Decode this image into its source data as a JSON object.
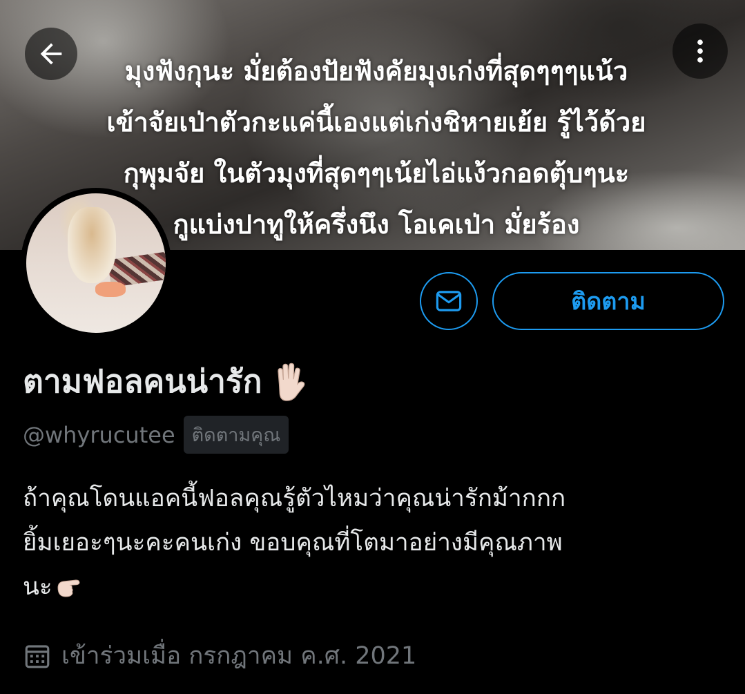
{
  "banner": {
    "caption_lines": [
      "มุงฟังกุนะ มั่ยต้องปัยฟังคัยมุงเก่งที่สุดๆๆๆแน้ว",
      "เข้าจัยเป่าตัวกะแค่นี้เองแต่เก่งชิหายเย้ย รู้ไว้ด้วย",
      "กุพุมจัย ในตัวมุงที่สุดๆๆเน้ยไอ่แง้วกอดตุ้บๆนะ",
      "กูแบ่งปาทูให้ครึ่งนึง โอเคเป่า มั่ยร้อง"
    ]
  },
  "nav": {
    "back_icon": "arrow-left-icon",
    "more_icon": "more-vertical-icon"
  },
  "profile": {
    "display_name": "ตามฟอลคนน่ารัก",
    "name_emoji": "raised-hand-emoji",
    "handle": "@whyrucutee",
    "follows_you_label": "ติดตามคุณ",
    "bio_lines": [
      "ถ้าคุณโดนแอคนี้ฟอลคุณรู้ตัวไหมว่าคุณน่ารักม้ากกก",
      "ยิ้มเยอะๆนะคะคนเก่ง ขอบคุณที่โตมาอย่างมีคุณภาพ",
      "นะ"
    ],
    "bio_emoji": "pointing-right-emoji",
    "joined_text": "เข้าร่วมเมื่อ กรกฎาคม ค.ศ. 2021"
  },
  "actions": {
    "message_icon": "mail-icon",
    "follow_label": "ติดตาม"
  },
  "colors": {
    "accent": "#1d9bf0",
    "background": "#000000",
    "text_primary": "#e7e9ea",
    "text_secondary": "#71767b"
  }
}
